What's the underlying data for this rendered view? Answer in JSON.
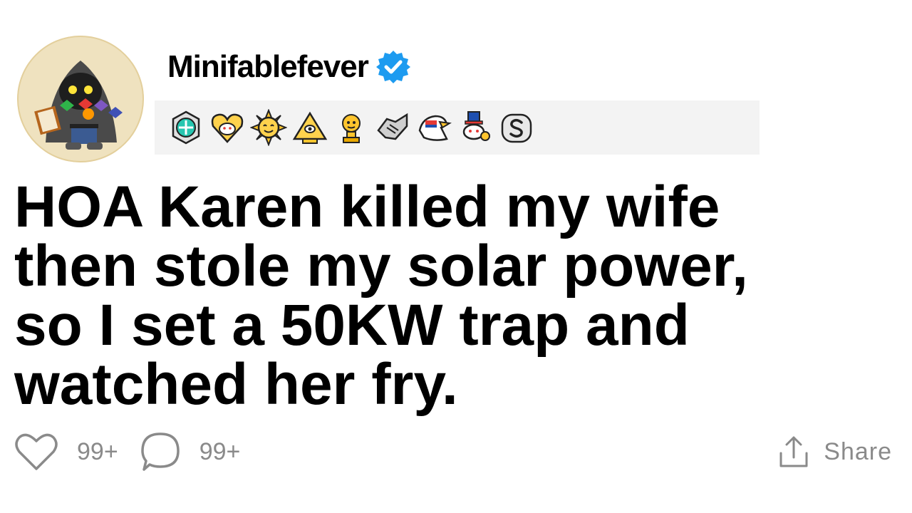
{
  "post": {
    "username": "Minifablefever",
    "verified": true,
    "title_lines": [
      "HOA Karen killed my wife",
      "then stole my solar power,",
      "so I set a 50KW trap and",
      "watched her fry."
    ],
    "awards": [
      "hexagon-badge-icon",
      "snoo-heart-icon",
      "sun-face-icon",
      "pyramid-eye-icon",
      "gold-trophy-icon",
      "handshake-icon",
      "eagle-icon",
      "snoo-top-hat-icon",
      "silver-s-icon"
    ],
    "likes": "99+",
    "comments": "99+",
    "share_label": "Share"
  },
  "colors": {
    "verified": "#1d9bf0",
    "muted": "#8a8a8a",
    "awards_bg": "#f3f3f3"
  }
}
